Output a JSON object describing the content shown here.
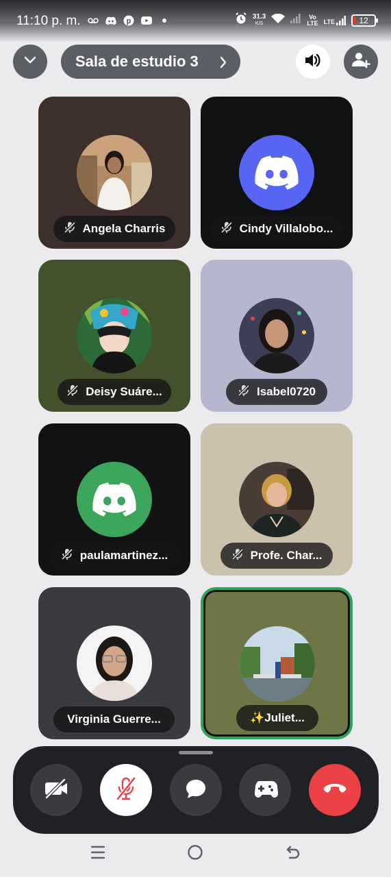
{
  "status_bar": {
    "time": "11:10 p. m.",
    "speed_value": "31.3",
    "speed_unit": "K/S",
    "volte_top": "Vo",
    "volte_bottom": "LTE",
    "lte": "LTE",
    "battery": "12"
  },
  "header": {
    "room_name": "Sala de estudio 3"
  },
  "participants": [
    {
      "name": "Angela Charris",
      "muted": true,
      "avatar": "photo"
    },
    {
      "name": "Cindy Villalobo...",
      "muted": true,
      "avatar": "discord-default-blue"
    },
    {
      "name": "Deisy Suáre...",
      "muted": true,
      "avatar": "photo"
    },
    {
      "name": "Isabel0720",
      "muted": true,
      "avatar": "photo"
    },
    {
      "name": "paulamartinez...",
      "muted": true,
      "avatar": "discord-default-green"
    },
    {
      "name": "Profe. Char...",
      "muted": true,
      "avatar": "photo"
    },
    {
      "name": "Virginia Guerre...",
      "muted": false,
      "avatar": "photo"
    },
    {
      "name": "✨Juliet...",
      "muted": false,
      "speaking": true,
      "avatar": "photo"
    }
  ],
  "controls": [
    "camera-off-icon",
    "microphone-muted-icon",
    "chat-icon",
    "activities-gamepad-icon",
    "hang-up-icon"
  ],
  "colors": {
    "discord_blurple": "#5865f2",
    "discord_green": "#3ba55c",
    "speaking_ring": "#2fa55b",
    "hang_up": "#ed4245",
    "muted_red": "#ed4245"
  }
}
